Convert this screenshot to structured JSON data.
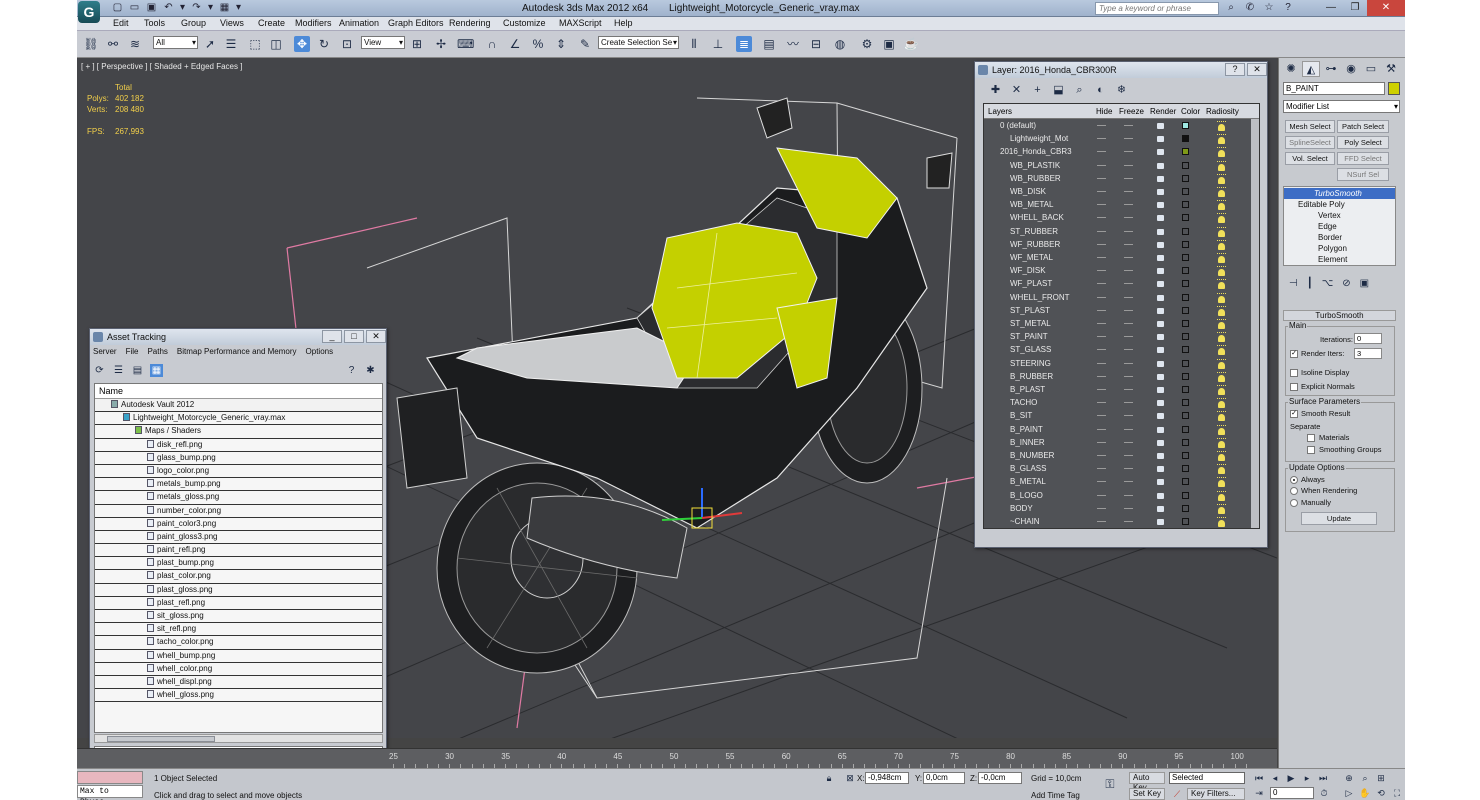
{
  "app": {
    "logo_char": "G",
    "title": "Autodesk 3ds Max  2012 x64",
    "file": "Lightweight_Motorcycle_Generic_vray.max",
    "search_placeholder": "Type a keyword or phrase",
    "quick_access_icons": [
      "new-icon",
      "open-icon",
      "save-icon",
      "undo-icon",
      "redo-icon",
      "project-icon"
    ],
    "title_icons": [
      "search-icon",
      "communication-center-icon",
      "favorites-icon",
      "help-icon"
    ]
  },
  "menu": [
    "Edit",
    "Tools",
    "Group",
    "Views",
    "Create",
    "Modifiers",
    "Animation",
    "Graph Editors",
    "Rendering",
    "Customize",
    "MAXScript",
    "Help"
  ],
  "toolbar": {
    "filter": "All",
    "ref_coord": "View",
    "named_selection": "Create Selection Se",
    "icons": [
      "link-icon",
      "unlink-icon",
      "bind-spacewarp-icon",
      "select-icon",
      "select-by-name-icon",
      "rect-region-icon",
      "window-crossing-icon",
      "move-icon",
      "rotate-icon",
      "scale-icon",
      "pivot-icon",
      "select-manipulate-icon",
      "keyboard-shortcut-icon",
      "snap-3d-icon",
      "angle-snap-icon",
      "percent-snap-icon",
      "spinner-snap-icon",
      "edit-named-sel-icon",
      "mirror-icon",
      "align-icon",
      "layer-manager-icon",
      "graphite-icon",
      "curve-editor-icon",
      "schematic-icon",
      "material-editor-icon",
      "render-setup-icon",
      "rendered-frame-icon",
      "render-icon"
    ]
  },
  "viewport": {
    "label": "[ + ] [ Perspective ] [ Shaded + Edged Faces ]",
    "stats": {
      "total_label": "Total",
      "polys_label": "Polys:",
      "polys": "402 182",
      "verts_label": "Verts:",
      "verts": "208 480",
      "fps_label": "FPS:",
      "fps": "267,993"
    }
  },
  "asset_tracking": {
    "title": "Asset Tracking",
    "menu": [
      "Server",
      "File",
      "Paths",
      "Bitmap Performance and Memory",
      "Options"
    ],
    "column": "Name",
    "vault": "Autodesk Vault 2012",
    "scene_file": "Lightweight_Motorcycle_Generic_vray.max",
    "maps_group": "Maps / Shaders",
    "files": [
      "disk_refl.png",
      "glass_bump.png",
      "logo_color.png",
      "metals_bump.png",
      "metals_gloss.png",
      "number_color.png",
      "paint_color3.png",
      "paint_gloss3.png",
      "paint_refl.png",
      "plast_bump.png",
      "plast_color.png",
      "plast_gloss.png",
      "plast_refl.png",
      "sit_gloss.png",
      "sit_refl.png",
      "tacho_color.png",
      "whell_bump.png",
      "whell_color.png",
      "whell_displ.png",
      "whell_gloss.png"
    ]
  },
  "layer_manager": {
    "title": "Layer: 2016_Honda_CBR300R",
    "columns": [
      "Layers",
      "Hide",
      "Freeze",
      "Render",
      "Color",
      "Radiosity"
    ],
    "layers": [
      {
        "name": "0 (default)",
        "level": 0,
        "color": "#9fe8e3"
      },
      {
        "name": "Lightweight_Mot",
        "level": 1,
        "color": "#111111"
      },
      {
        "name": "2016_Honda_CBR3",
        "level": 0,
        "color": "#7f9a18"
      },
      {
        "name": "WB_PLASTIK",
        "level": 1,
        "color": ""
      },
      {
        "name": "WB_RUBBER",
        "level": 1,
        "color": ""
      },
      {
        "name": "WB_DISK",
        "level": 1,
        "color": ""
      },
      {
        "name": "WB_METAL",
        "level": 1,
        "color": ""
      },
      {
        "name": "WHELL_BACK",
        "level": 1,
        "color": ""
      },
      {
        "name": "ST_RUBBER",
        "level": 1,
        "color": ""
      },
      {
        "name": "WF_RUBBER",
        "level": 1,
        "color": ""
      },
      {
        "name": "WF_METAL",
        "level": 1,
        "color": ""
      },
      {
        "name": "WF_DISK",
        "level": 1,
        "color": ""
      },
      {
        "name": "WF_PLAST",
        "level": 1,
        "color": ""
      },
      {
        "name": "WHELL_FRONT",
        "level": 1,
        "color": ""
      },
      {
        "name": "ST_PLAST",
        "level": 1,
        "color": ""
      },
      {
        "name": "ST_METAL",
        "level": 1,
        "color": ""
      },
      {
        "name": "ST_PAINT",
        "level": 1,
        "color": ""
      },
      {
        "name": "ST_GLASS",
        "level": 1,
        "color": ""
      },
      {
        "name": "STEERING",
        "level": 1,
        "color": ""
      },
      {
        "name": "B_RUBBER",
        "level": 1,
        "color": ""
      },
      {
        "name": "B_PLAST",
        "level": 1,
        "color": ""
      },
      {
        "name": "TACHO",
        "level": 1,
        "color": ""
      },
      {
        "name": "B_SIT",
        "level": 1,
        "color": ""
      },
      {
        "name": "B_PAINT",
        "level": 1,
        "color": ""
      },
      {
        "name": "B_INNER",
        "level": 1,
        "color": ""
      },
      {
        "name": "B_NUMBER",
        "level": 1,
        "color": ""
      },
      {
        "name": "B_GLASS",
        "level": 1,
        "color": ""
      },
      {
        "name": "B_METAL",
        "level": 1,
        "color": ""
      },
      {
        "name": "B_LOGO",
        "level": 1,
        "color": ""
      },
      {
        "name": "BODY",
        "level": 1,
        "color": ""
      },
      {
        "name": "~CHAIN",
        "level": 1,
        "color": ""
      }
    ]
  },
  "command_panel": {
    "object_name": "B_PAINT",
    "object_color": "#ced000",
    "modifier_list": "Modifier List",
    "buttons": [
      "Mesh Select",
      "Patch Select",
      "SplineSelect",
      "Poly Select",
      "Vol. Select",
      "FFD Select",
      "NSurf Sel"
    ],
    "stack": {
      "turbosmooth": "TurboSmooth",
      "editable_poly": "Editable Poly",
      "subs": [
        "Vertex",
        "Edge",
        "Border",
        "Polygon",
        "Element"
      ]
    },
    "turbosmooth": {
      "title": "TurboSmooth",
      "main": "Main",
      "iterations_label": "Iterations:",
      "iterations": "0",
      "render_iters_label": "Render Iters:",
      "render_iters": "3",
      "isoline": "Isoline Display",
      "explicit_normals": "Explicit Normals",
      "surface_params": "Surface Parameters",
      "smooth_result": "Smooth Result",
      "separate": "Separate",
      "materials": "Materials",
      "smoothing_groups": "Smoothing Groups",
      "update_options": "Update Options",
      "always": "Always",
      "when_rendering": "When Rendering",
      "manually": "Manually",
      "update": "Update"
    }
  },
  "timeline": {
    "ticks": [
      "25",
      "30",
      "35",
      "40",
      "45",
      "50",
      "55",
      "60",
      "65",
      "70",
      "75",
      "80",
      "85",
      "90",
      "95",
      "100"
    ]
  },
  "status": {
    "listener": "Max to Physc.",
    "selected": "1 Object Selected",
    "prompt": "Click and drag to select and move objects",
    "x": "-0,948cm",
    "y": "0,0cm",
    "z": "-0,0cm",
    "grid": "Grid = 10,0cm",
    "auto_key": "Auto Key",
    "set_key": "Set Key",
    "selected_mode": "Selected",
    "key_filters": "Key Filters...",
    "add_time_tag": "Add Time Tag",
    "frame": "0"
  }
}
